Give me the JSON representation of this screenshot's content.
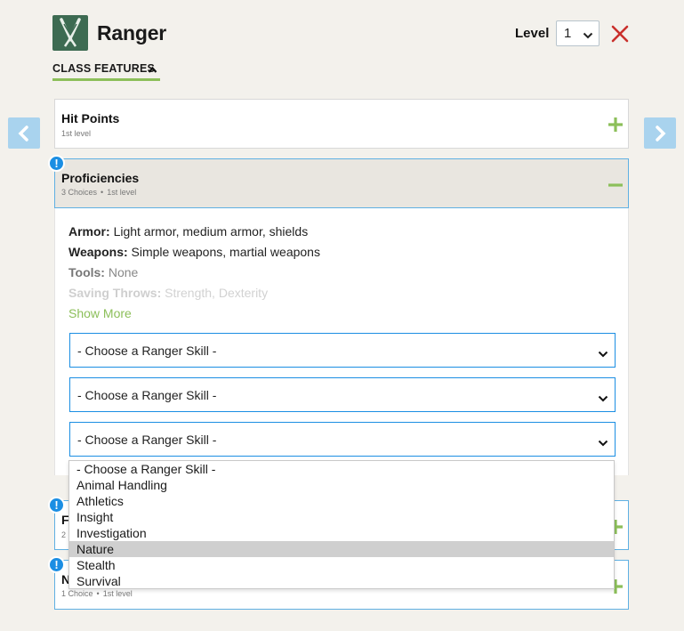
{
  "header": {
    "class_name": "Ranger",
    "level_label": "Level",
    "level_value": "1",
    "close_label": "✕"
  },
  "tabs": {
    "class_features_label": "CLASS FEATURES"
  },
  "features": [
    {
      "title": "Hit Points",
      "subtitle": "1st level",
      "state": "collapsed"
    },
    {
      "title": "Proficiencies",
      "choices": "3 Choices",
      "subtitle": "1st level",
      "state": "expanded",
      "alert": true
    },
    {
      "title": "F",
      "choices": "2",
      "state": "collapsed",
      "alert": true
    },
    {
      "title": "N",
      "choices": "1 Choice",
      "subtitle": "1st level",
      "state": "collapsed",
      "alert": true
    }
  ],
  "proficiencies": {
    "armor_label": "Armor:",
    "armor_value": "Light armor, medium armor, shields",
    "weapons_label": "Weapons:",
    "weapons_value": "Simple weapons, martial weapons",
    "tools_label": "Tools:",
    "tools_value": "None",
    "saving_label": "Saving Throws:",
    "saving_value": "Strength, Dexterity",
    "show_more": "Show More",
    "skill_selects": [
      "- Choose a Ranger Skill -",
      "- Choose a Ranger Skill -",
      "- Choose a Ranger Skill -"
    ]
  },
  "dropdown": {
    "options": [
      "- Choose a Ranger Skill -",
      "Animal Handling",
      "Athletics",
      "Insight",
      "Investigation",
      "Nature",
      "Stealth",
      "Survival"
    ],
    "highlighted": "Nature"
  },
  "colors": {
    "accent_green": "#8cbf5a",
    "alert_blue": "#1b8ee3",
    "nav_arrow_blue": "#a9d3ee",
    "close_red": "#c9302c",
    "class_icon_bg": "#3d6b52"
  },
  "icons": {
    "class": "ranger-class-icon",
    "close": "close-icon",
    "prev": "chevron-left-icon",
    "next": "chevron-right-icon",
    "expand": "plus-icon",
    "collapse": "minus-icon",
    "alert": "exclamation-icon",
    "select": "chevron-down-icon"
  }
}
